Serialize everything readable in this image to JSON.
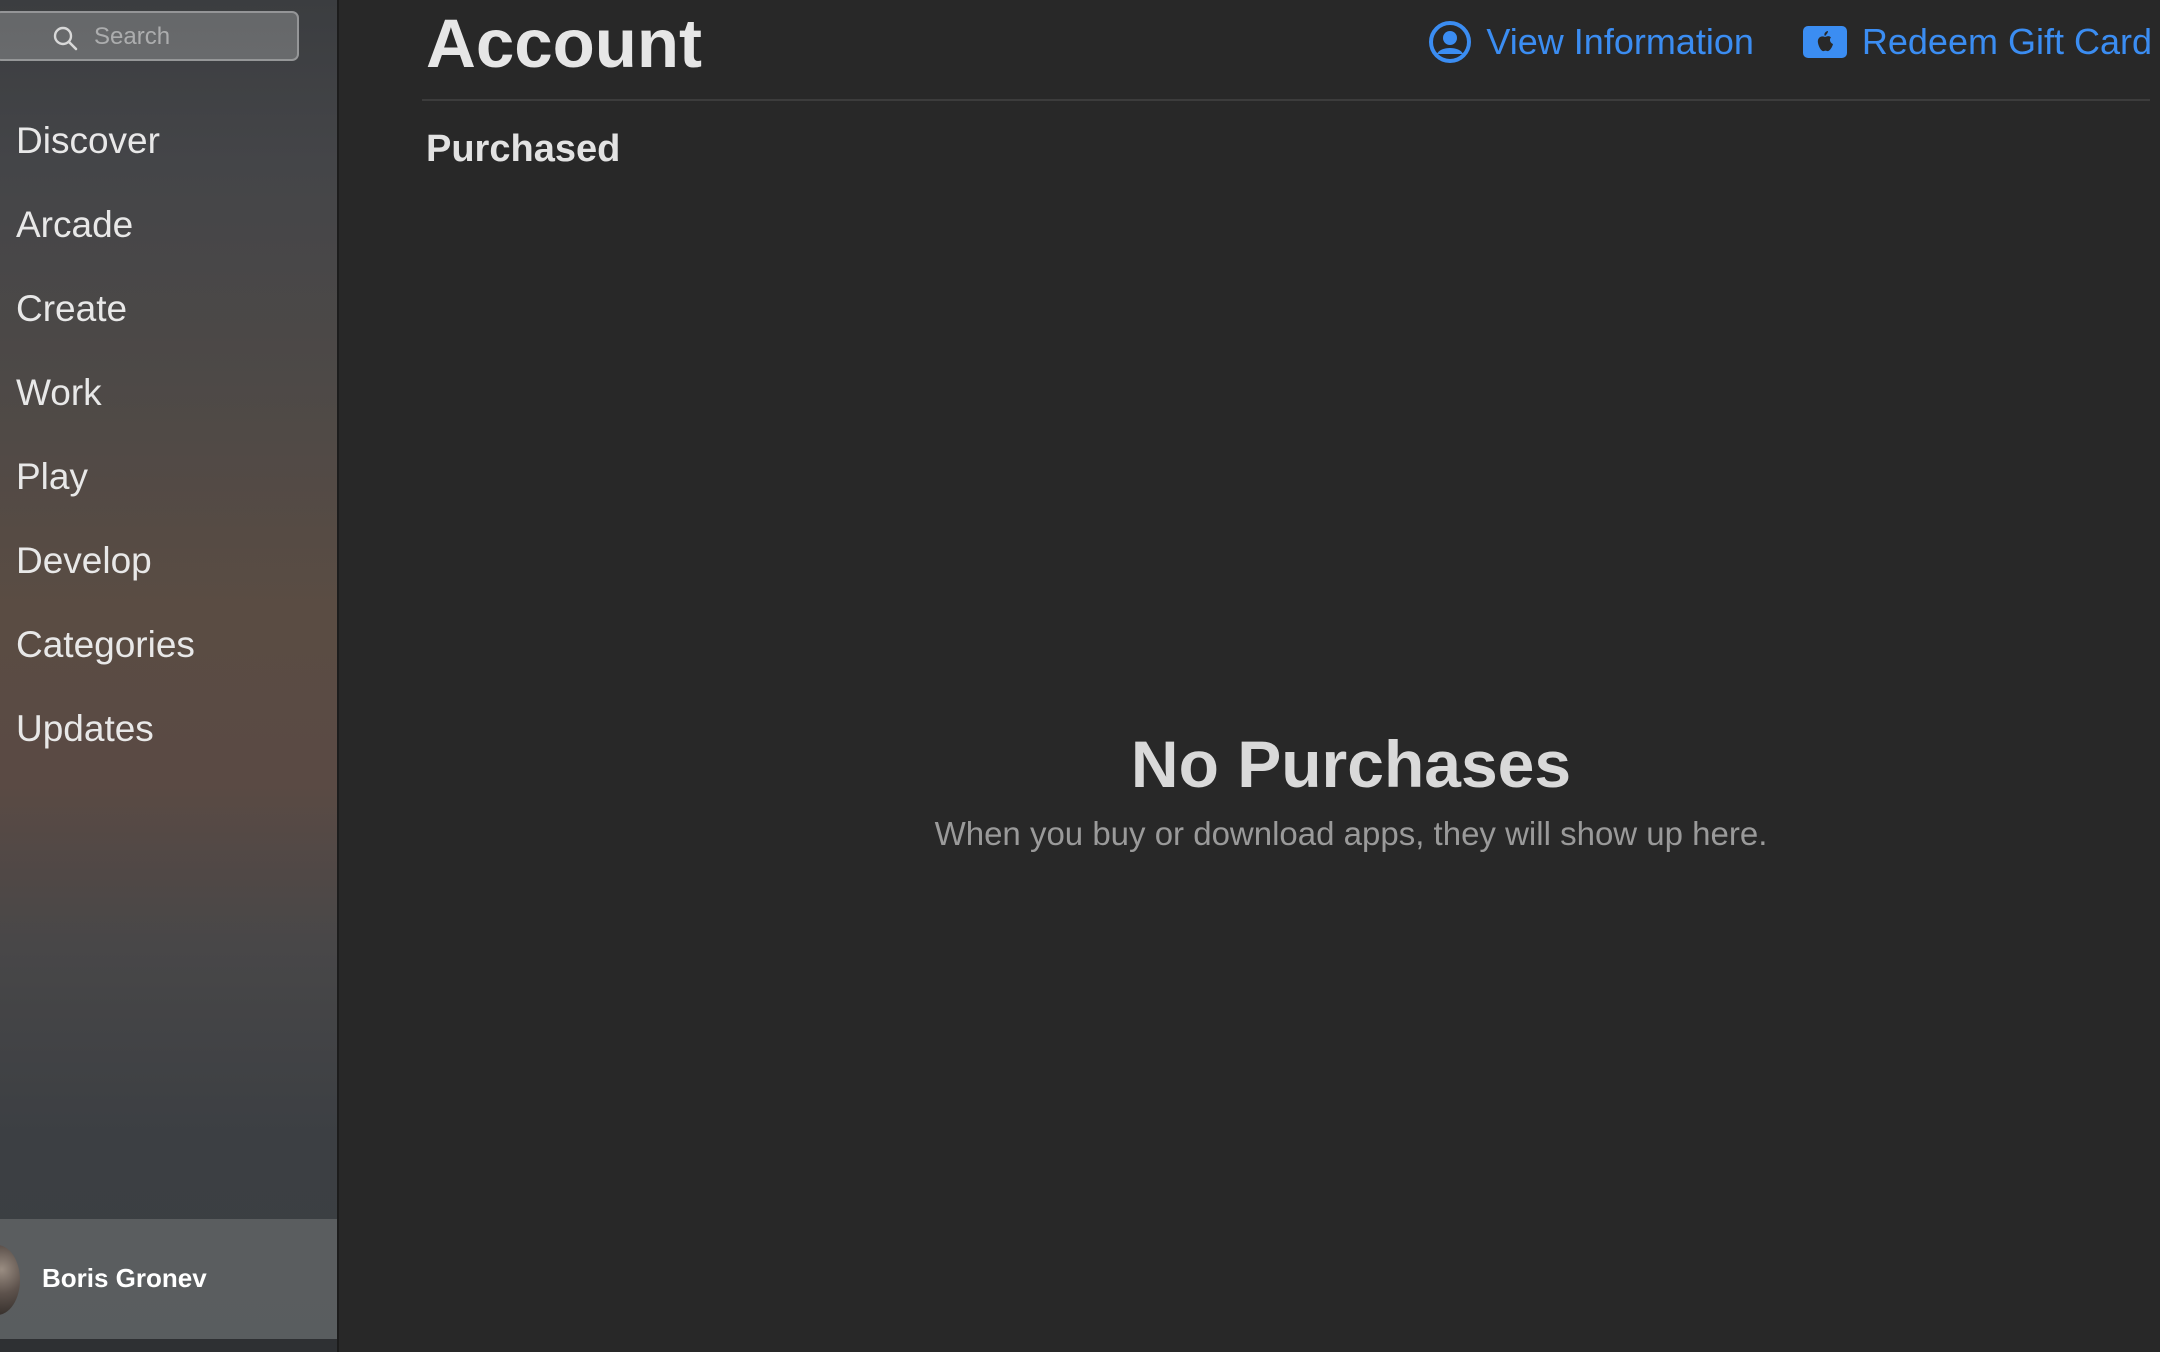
{
  "sidebar": {
    "search": {
      "placeholder": "Search",
      "value": ""
    },
    "items": [
      {
        "label": "Discover"
      },
      {
        "label": "Arcade"
      },
      {
        "label": "Create"
      },
      {
        "label": "Work"
      },
      {
        "label": "Play"
      },
      {
        "label": "Develop"
      },
      {
        "label": "Categories"
      },
      {
        "label": "Updates"
      }
    ],
    "user": {
      "name": "Boris Gronev"
    }
  },
  "header": {
    "title": "Account",
    "actions": {
      "view_information": "View Information",
      "redeem_gift_card": "Redeem Gift Card"
    }
  },
  "main": {
    "section_title": "Purchased",
    "empty_state": {
      "title": "No Purchases",
      "subtitle": "When you buy or download apps, they will show up here."
    }
  },
  "colors": {
    "accent": "#3b8df2",
    "background": "#282828"
  }
}
